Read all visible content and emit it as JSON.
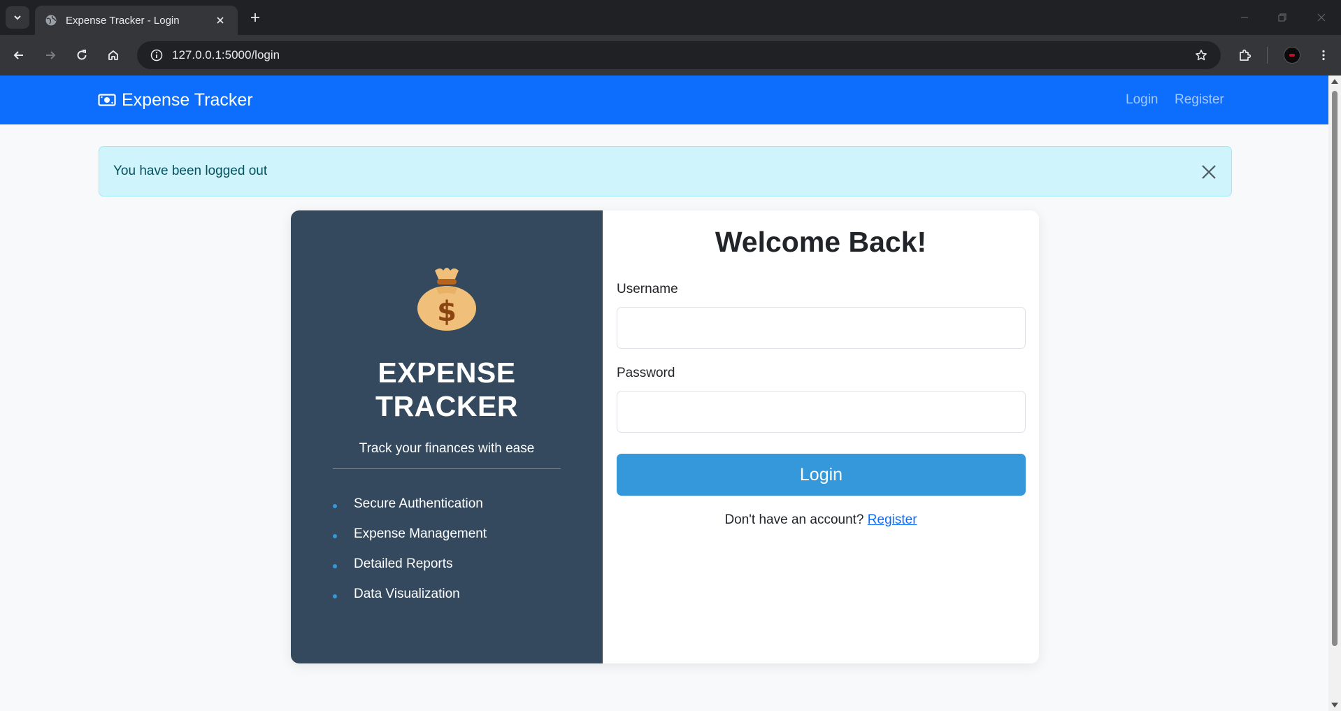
{
  "browser": {
    "tab_title": "Expense Tracker - Login",
    "url": "127.0.0.1:5000/login"
  },
  "navbar": {
    "brand": "Expense Tracker",
    "links": [
      {
        "label": "Login"
      },
      {
        "label": "Register"
      }
    ],
    "color": "#0d6efd"
  },
  "alert": {
    "message": "You have been logged out"
  },
  "sidebar": {
    "title_line1": "EXPENSE",
    "title_line2": "TRACKER",
    "tagline": "Track your finances with ease",
    "features": [
      "Secure Authentication",
      "Expense Management",
      "Detailed Reports",
      "Data Visualization"
    ],
    "icon": "money-bag-icon",
    "bg_color": "#34495e"
  },
  "form": {
    "heading": "Welcome Back!",
    "username_label": "Username",
    "username_value": "",
    "password_label": "Password",
    "password_value": "",
    "submit_label": "Login",
    "signup_prompt": "Don't have an account?",
    "signup_link": "Register",
    "button_color": "#3498db"
  }
}
